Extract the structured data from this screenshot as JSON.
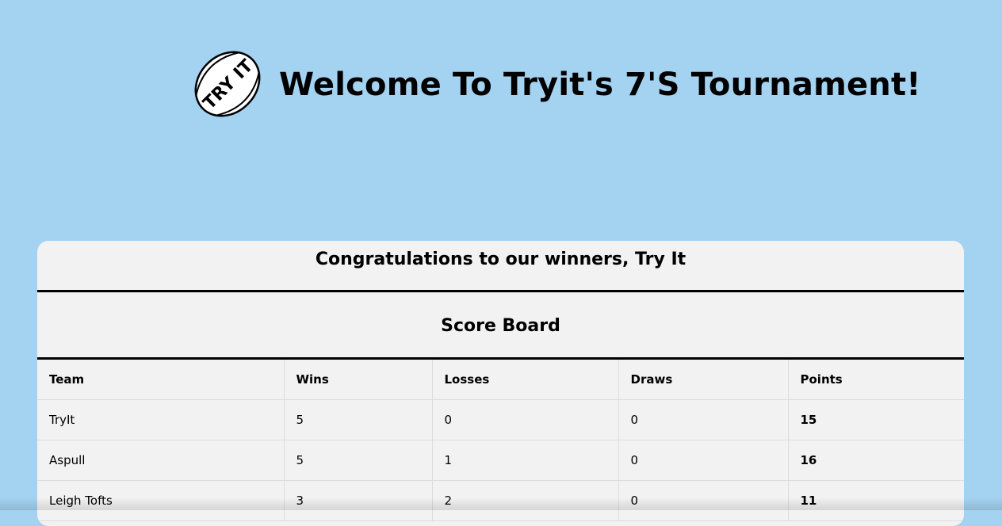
{
  "header": {
    "logo_text": "TRY IT",
    "title": "Welcome To Tryit's 7'S Tournament!"
  },
  "card": {
    "winners_text": "Congratulations to our winners, Try It",
    "scoreboard_title": "Score Board"
  },
  "table": {
    "columns": [
      "Team",
      "Wins",
      "Losses",
      "Draws",
      "Points"
    ],
    "rows": [
      {
        "team": "TryIt",
        "wins": "5",
        "losses": "0",
        "draws": "0",
        "points": "15"
      },
      {
        "team": "Aspull",
        "wins": "5",
        "losses": "1",
        "draws": "0",
        "points": "16"
      },
      {
        "team": "Leigh Tofts",
        "wins": "3",
        "losses": "2",
        "draws": "0",
        "points": "11"
      }
    ]
  }
}
